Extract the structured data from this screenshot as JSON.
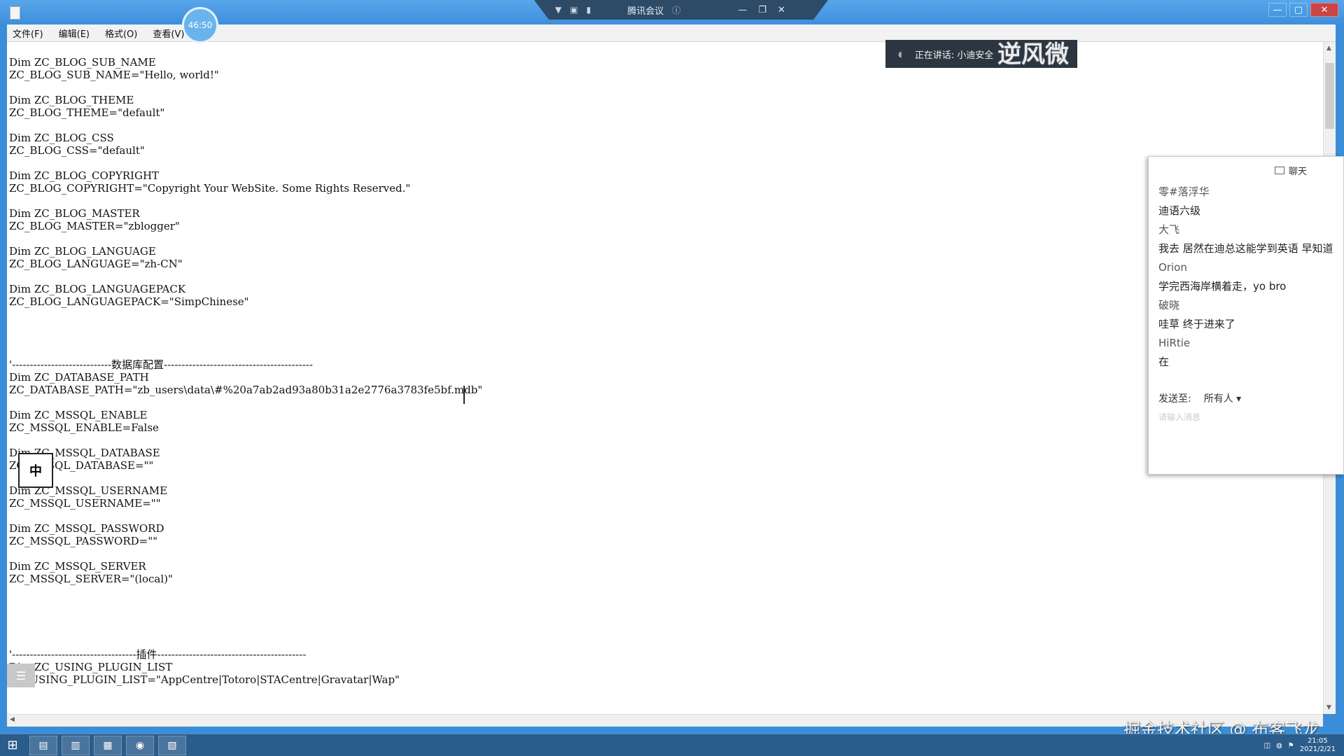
{
  "menu": [
    "文件(F)",
    "编辑(E)",
    "格式(O)",
    "查看(V)"
  ],
  "timer": "46:50",
  "meeting": {
    "title": "腾讯会议"
  },
  "speaking": {
    "label": "正在讲话: 小迪安全"
  },
  "overlay_text": "逆风微",
  "code_lines": [
    "Dim ZC_BLOG_SUB_NAME",
    "ZC_BLOG_SUB_NAME=\"Hello, world!\"",
    "",
    "Dim ZC_BLOG_THEME",
    "ZC_BLOG_THEME=\"default\"",
    "",
    "Dim ZC_BLOG_CSS",
    "ZC_BLOG_CSS=\"default\"",
    "",
    "Dim ZC_BLOG_COPYRIGHT",
    "ZC_BLOG_COPYRIGHT=\"Copyright Your WebSite. Some Rights Reserved.\"",
    "",
    "Dim ZC_BLOG_MASTER",
    "ZC_BLOG_MASTER=\"zblogger\"",
    "",
    "Dim ZC_BLOG_LANGUAGE",
    "ZC_BLOG_LANGUAGE=\"zh-CN\"",
    "",
    "Dim ZC_BLOG_LANGUAGEPACK",
    "ZC_BLOG_LANGUAGEPACK=\"SimpChinese\"",
    "",
    "",
    "",
    "",
    "'----------------------------数据库配置------------------------------------------",
    "Dim ZC_DATABASE_PATH",
    "ZC_DATABASE_PATH=\"zb_users\\data\\#%20a7ab2ad93a80b31a2e2776a3783fe5bf.mdb\"",
    "",
    "Dim ZC_MSSQL_ENABLE",
    "ZC_MSSQL_ENABLE=False",
    "",
    "Dim ZC_MSSQL_DATABASE",
    "ZC_MSSQL_DATABASE=\"\"",
    "",
    "Dim ZC_MSSQL_USERNAME",
    "ZC_MSSQL_USERNAME=\"\"",
    "",
    "Dim ZC_MSSQL_PASSWORD",
    "ZC_MSSQL_PASSWORD=\"\"",
    "",
    "Dim ZC_MSSQL_SERVER",
    "ZC_MSSQL_SERVER=\"(local)\"",
    "",
    "",
    "",
    "",
    "",
    "'-----------------------------------插件------------------------------------------",
    "Dim ZC_USING_PLUGIN_LIST",
    "ZC_USING_PLUGIN_LIST=\"AppCentre|Totoro|STACentre|Gravatar|Wap\""
  ],
  "ime": "中",
  "chat": {
    "title": "聊天",
    "messages": [
      {
        "sender": "零#落浮华",
        "text": "迪语六级"
      },
      {
        "sender": "大飞",
        "text": "我去 居然在迪总这能学到英语 早知道"
      },
      {
        "sender": "Orion",
        "text": "学完西海岸横着走，yo bro"
      },
      {
        "sender": "破晓",
        "text": "哇草 终于进来了"
      },
      {
        "sender": "HiRtie",
        "text": "在"
      }
    ],
    "send_to_label": "发送至:",
    "send_to_value": "所有人",
    "input_placeholder": "请输入消息"
  },
  "watermark": "掘金技术社区 @ 布客飞龙",
  "taskbar": {
    "clock_time": "21:05",
    "clock_date": "2021/2/21"
  }
}
